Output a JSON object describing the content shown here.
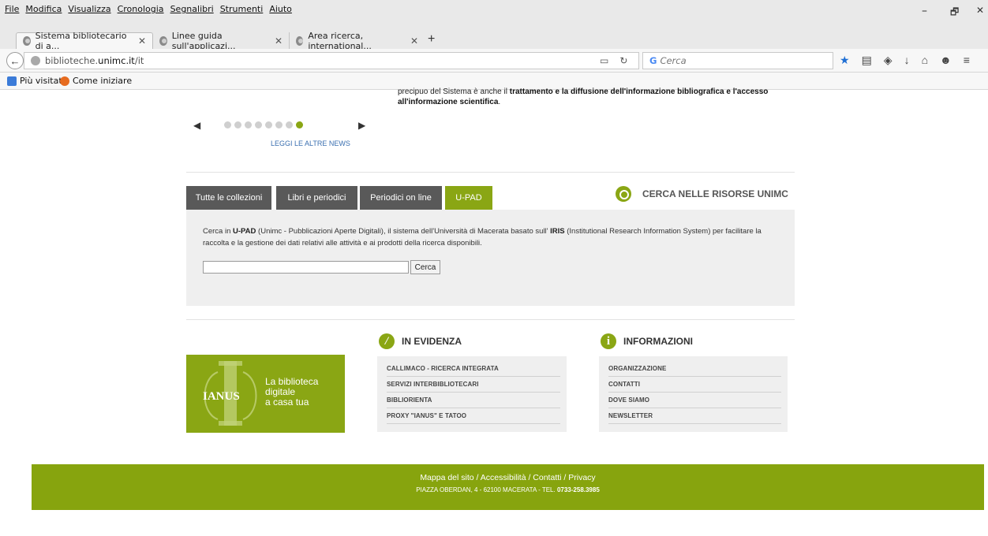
{
  "browser": {
    "menu": [
      "File",
      "Modifica",
      "Visualizza",
      "Cronologia",
      "Segnalibri",
      "Strumenti",
      "Aiuto"
    ],
    "tabs": [
      {
        "label": "Sistema bibliotecario di a...",
        "active": true
      },
      {
        "label": "Linee guida sull'applicazi...",
        "active": false
      },
      {
        "label": "Area ricerca, international...",
        "active": false
      }
    ],
    "newtab_label": "+",
    "url_prefix": "biblioteche.",
    "url_host": "unimc.it",
    "url_path": "/it",
    "search_placeholder": "Cerca",
    "bookmarks": [
      "Più visitati",
      "Come iniziare"
    ],
    "window_controls": [
      "–",
      "🗗",
      "✕"
    ]
  },
  "news": {
    "text_start": "precipuo del Sistema è anche il ",
    "text_bold": "trattamento e la diffusione dell'informazione bibliografica e l'accesso all'informazione scientifica",
    "text_end": ".",
    "read_more": "LEGGI LE ALTRE NEWS",
    "dots_total": 8,
    "dot_active_index": 7
  },
  "search": {
    "tabs": [
      "Tutte le collezioni",
      "Libri e periodici",
      "Periodici on line",
      "U-PAD"
    ],
    "active_tab": "U-PAD",
    "heading": "CERCA NELLE RISORSE UNIMC",
    "desc_1": "Cerca in ",
    "desc_bold_1": "U-PAD",
    "desc_2": " (Unimc - Pubblicazioni Aperte Digitali), il sistema dell'Università di Macerata basato sull' ",
    "desc_bold_2": "IRIS",
    "desc_3": " (Institutional Research Information System) per facilitare la raccolta e la gestione dei dati relativi alle attività e ai prodotti della ricerca disponibili.",
    "input_value": "",
    "button_label": "Cerca"
  },
  "ianus": {
    "logo_text": "IANUS",
    "tagline_1": "La biblioteca",
    "tagline_2": "digitale",
    "tagline_3": "a casa tua"
  },
  "evidenza": {
    "heading": "IN EVIDENZA",
    "items": [
      "CALLIMACO - RICERCA INTEGRATA",
      "SERVIZI INTERBIBLIOTECARI",
      "BIBLIORIENTA",
      "PROXY \"IANUS\" E TATOO"
    ]
  },
  "informazioni": {
    "heading": "INFORMAZIONI",
    "items": [
      "ORGANIZZAZIONE",
      "CONTATTI",
      "DOVE SIAMO",
      "NEWSLETTER"
    ]
  },
  "footer": {
    "links": "Mappa del sito  /  Accessibilità  /  Contatti  /  Privacy",
    "address": "PIAZZA OBERDAN, 4 - 62100 MACERATA - TEL. ",
    "phone": "0733-258.3985"
  },
  "colors": {
    "accent_green": "#8aa614",
    "tab_gray": "#595959",
    "panel_gray": "#efefef"
  }
}
